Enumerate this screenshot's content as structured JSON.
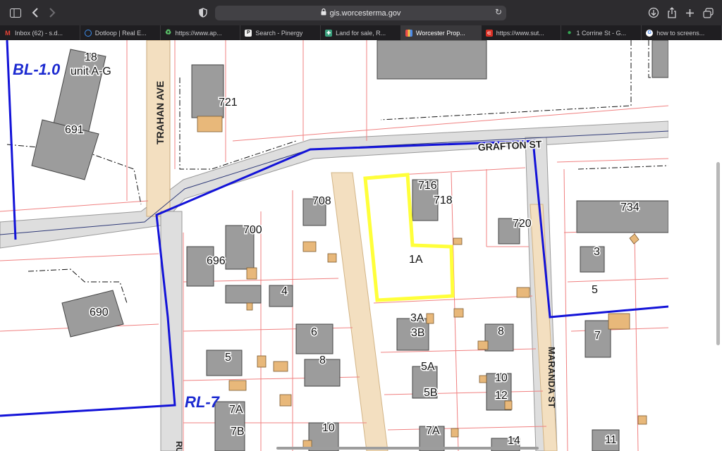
{
  "browser": {
    "address": "gis.worcesterma.gov",
    "tabs": [
      {
        "label": "Inbox (62) - s.d...",
        "icon": "gmail-icon",
        "color": "#d93025",
        "glyph": "M"
      },
      {
        "label": "Dotloop | Real E...",
        "icon": "dotloop-icon",
        "color": "#2f7de1",
        "glyph": "◌"
      },
      {
        "label": "https://www.ap...",
        "icon": "recycle-icon",
        "color": "#34a853",
        "glyph": "♻"
      },
      {
        "label": "Search - Pinergy",
        "icon": "pinergy-icon",
        "color": "#f2f2f2",
        "glyph": "P"
      },
      {
        "label": "Land for sale, R...",
        "icon": "land-icon",
        "color": "#3aa17e",
        "glyph": "✚"
      },
      {
        "label": "Worcester Prop...",
        "icon": "worcester-icon",
        "color": "#8e5bd6",
        "glyph": "▦"
      },
      {
        "label": "https://www.sut...",
        "icon": "sut-icon",
        "color": "#d93025",
        "glyph": "⊂"
      },
      {
        "label": "1 Corrine St - G...",
        "icon": "maps-pin-icon",
        "color": "#34a853",
        "glyph": "●"
      },
      {
        "label": "how to screens...",
        "icon": "google-icon",
        "color": "#ffffff",
        "glyph": "G"
      }
    ],
    "active_tab": 5
  },
  "map": {
    "streets": [
      "GRAFTON ST",
      "TRAHAN AVE",
      "MARANDA ST",
      "RU"
    ],
    "zones": [
      "BL-1.0",
      "RL-7"
    ],
    "lot_numbers": [
      "18",
      "unit A-G",
      "691",
      "721",
      "716",
      "718",
      "708",
      "700",
      "720",
      "734",
      "696",
      "1A",
      "3",
      "690",
      "4",
      "5",
      "3A",
      "3B",
      "6",
      "8",
      "7",
      "5",
      "8",
      "5A",
      "5B",
      "10",
      "12",
      "7A",
      "7B",
      "7A",
      "10",
      "14",
      "11"
    ],
    "colors": {
      "zone_line": "#1010e0",
      "parcel_line": "#f08a8a",
      "road": "#dcdcdc",
      "building": "#999999",
      "highlight": "#ffff40",
      "path": "#f0d9b5"
    }
  }
}
